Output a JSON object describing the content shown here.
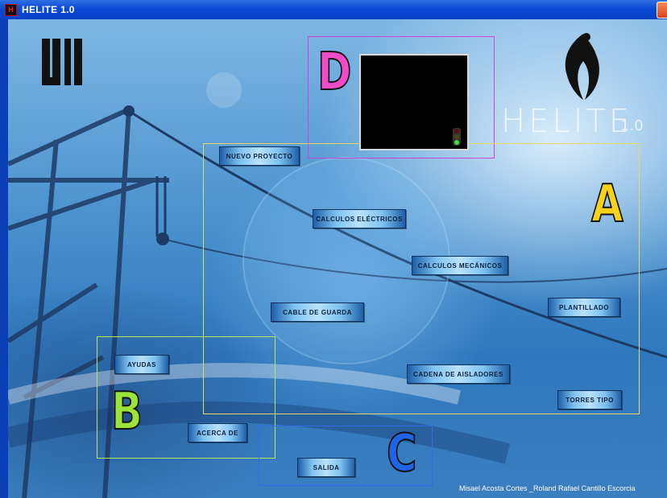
{
  "window": {
    "title": "HELITE 1.0"
  },
  "branding": {
    "product_name": "HELITE",
    "version": "1.0",
    "left_logo": "uis-logo",
    "right_logo": "helite-emblem"
  },
  "zones": {
    "a": "A",
    "b": "B",
    "c": "C",
    "d": "D"
  },
  "buttons": {
    "nuevo_proyecto": "Nuevo Proyecto",
    "calculos_electricos": "Calculos Eléctricos",
    "calculos_mecanicos": "Calculos Mecánicos",
    "cable_de_guarda": "Cable de Guarda",
    "plantillado": "Plantillado",
    "cadena_de_aisladores": "Cadena de Aisladores",
    "torres_tipo": "Torres Tipo",
    "ayudas": "Ayudas",
    "acerca_de": "Acerca de",
    "salida": "Salida"
  },
  "credits": "Misael Acosta Cortes  _Roland Rafael Cantillo Escorcia",
  "colors": {
    "zone_a": "#e8d86a",
    "zone_b": "#b6e85a",
    "zone_c": "#2f6ee8",
    "zone_d": "#d044d8",
    "letter_a": "#f7d21a",
    "letter_b": "#9be33a",
    "letter_c": "#1f63e6",
    "letter_d": "#f04bc7",
    "titlebar": "#0a4ad6"
  },
  "traffic_light": {
    "red": "#5a1010",
    "yellow": "#4a4a10",
    "green": "#3fe03a"
  }
}
